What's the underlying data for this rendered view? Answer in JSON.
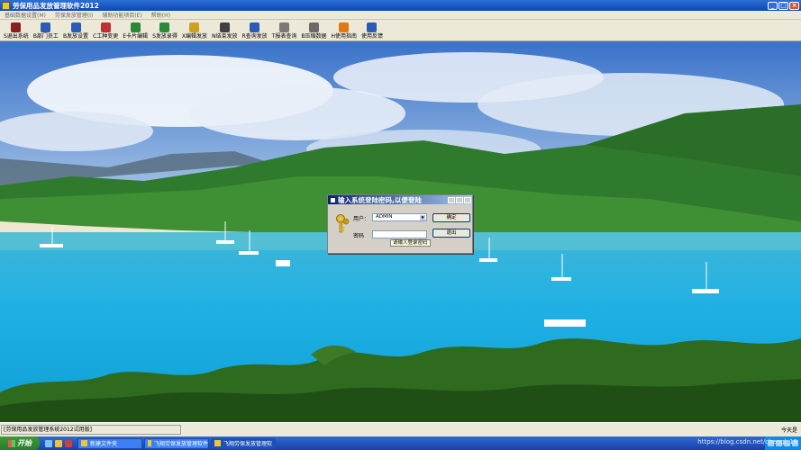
{
  "window": {
    "title": "劳保用品发放管理软件2012"
  },
  "menu": [
    "基础数据设置(M)",
    "劳保发放管理(I)",
    "辅助功能项目(E)",
    "帮助(H)"
  ],
  "toolbar": [
    {
      "label": "S退出系统",
      "icon": "exit-icon",
      "color": "#8a1f1f"
    },
    {
      "label": "B部门员工",
      "icon": "people-icon",
      "color": "#2b5bb5"
    },
    {
      "label": "B发放设置",
      "icon": "settings-icon",
      "color": "#2b5bb5"
    },
    {
      "label": "C工种变更",
      "icon": "swap-icon",
      "color": "#c03030"
    },
    {
      "label": "E卡片编辑",
      "icon": "card-icon",
      "color": "#2a8a3a"
    },
    {
      "label": "S发放录得",
      "icon": "record-icon",
      "color": "#2a8a3a"
    },
    {
      "label": "X编辑发放",
      "icon": "pencil-icon",
      "color": "#d0a020"
    },
    {
      "label": "N结束发放",
      "icon": "save-icon",
      "color": "#404040"
    },
    {
      "label": "R查询发放",
      "icon": "search-icon",
      "color": "#2b5bb5"
    },
    {
      "label": "T报表查询",
      "icon": "report-icon",
      "color": "#7a7a7a"
    },
    {
      "label": "B压缩数据",
      "icon": "database-icon",
      "color": "#6a6a6a"
    },
    {
      "label": "H使用指南",
      "icon": "help-icon",
      "color": "#e07a10"
    },
    {
      "label": "使用反馈",
      "icon": "feedback-icon",
      "color": "#2b5bb5"
    }
  ],
  "dialog": {
    "title": "输入系统登陆密码,以便登陆",
    "user_label": "用户：",
    "user_value": "ADMIN",
    "password_label": "密码",
    "hint": "请输入登录密码",
    "ok_label": "确定",
    "cancel_label": "退出"
  },
  "status": {
    "left": "[劳保用品发放管理系统2012试用版]",
    "right": "今天是"
  },
  "taskbar": {
    "start_label": "开始",
    "tasks": [
      "新建文件夹",
      "飞翔劳保发放管理软件",
      "飞翔劳保发放管理软"
    ],
    "watermark": "https://blog.csdn.net/chengl_19"
  }
}
